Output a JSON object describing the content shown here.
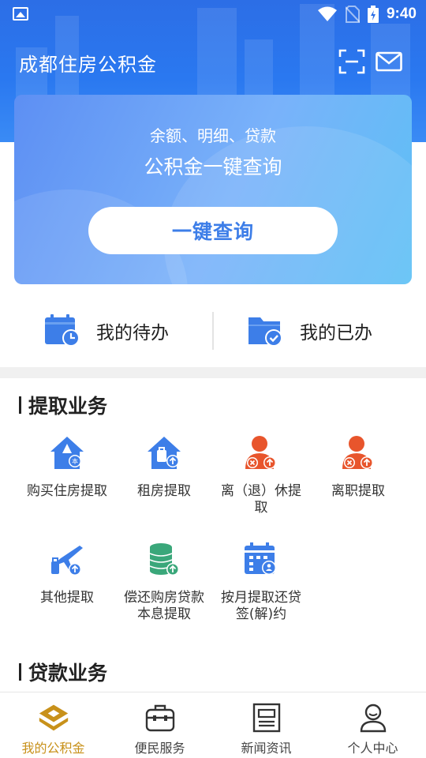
{
  "status_bar": {
    "time": "9:40"
  },
  "header": {
    "title": "成都住房公积金",
    "scan_icon": "scan-icon",
    "mail_icon": "mail-icon"
  },
  "query_card": {
    "subtitle": "余额、明细、贷款",
    "title": "公积金一键查询",
    "button_label": "一键查询"
  },
  "tasks": {
    "todo_label": "我的待办",
    "done_label": "我的已办"
  },
  "withdrawal": {
    "title": "提取业务",
    "items": [
      {
        "label": "购买住房提取",
        "icon": "house-purchase-icon"
      },
      {
        "label": "租房提取",
        "icon": "rent-house-icon"
      },
      {
        "label": "离（退）休提取",
        "icon": "retire-person-icon"
      },
      {
        "label": "离职提取",
        "icon": "resign-person-icon"
      },
      {
        "label": "其他提取",
        "icon": "travel-plane-icon"
      },
      {
        "label": "偿还购房贷款本息提取",
        "icon": "coin-stack-icon"
      },
      {
        "label": "按月提取还贷签(解)约",
        "icon": "calendar-sign-icon"
      }
    ]
  },
  "loan": {
    "title": "贷款业务"
  },
  "bottom_nav": {
    "items": [
      {
        "label": "我的公积金",
        "icon": "fund-logo-icon",
        "active": true
      },
      {
        "label": "便民服务",
        "icon": "toolbox-icon",
        "active": false
      },
      {
        "label": "新闻资讯",
        "icon": "news-icon",
        "active": false
      },
      {
        "label": "个人中心",
        "icon": "person-icon",
        "active": false
      }
    ]
  },
  "colors": {
    "primary_blue": "#2a78f0",
    "accent_orange": "#e8552c",
    "nav_active": "#c8911a",
    "green": "#3aa77a"
  }
}
